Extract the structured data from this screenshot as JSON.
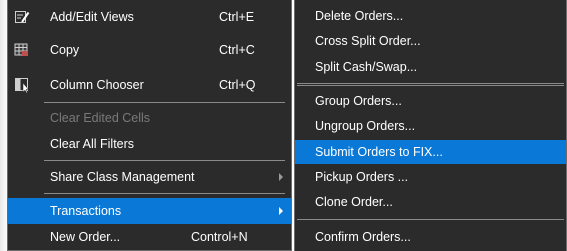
{
  "main_menu": {
    "items": [
      {
        "label": "Add/Edit Views",
        "shortcut": "Ctrl+E",
        "icon": "edit-views-icon"
      },
      {
        "label": "Copy",
        "shortcut": "Ctrl+C",
        "icon": "copy-grid-icon"
      },
      {
        "label": "Column Chooser",
        "shortcut": "Ctrl+Q",
        "icon": "column-chooser-icon"
      },
      {
        "label": "Clear Edited Cells",
        "shortcut": "",
        "disabled": true
      },
      {
        "label": "Clear All Filters",
        "shortcut": ""
      },
      {
        "label": "Share Class Management",
        "shortcut": "",
        "submenu": true
      },
      {
        "label": "Transactions",
        "shortcut": "",
        "submenu": true,
        "highlighted": true
      },
      {
        "label": "New Order...",
        "shortcut": "Control+N"
      }
    ]
  },
  "sub_menu": {
    "items": [
      {
        "label": "Delete Orders..."
      },
      {
        "label": "Cross Split Order..."
      },
      {
        "label": "Split Cash/Swap..."
      },
      {
        "label": "Group Orders..."
      },
      {
        "label": "Ungroup Orders..."
      },
      {
        "label": "Submit Orders to FIX...",
        "highlighted": true
      },
      {
        "label": "Pickup Orders ..."
      },
      {
        "label": "Clone Order..."
      },
      {
        "label": "Confirm Orders..."
      }
    ]
  },
  "colors": {
    "menu_bg": "#2b2b2b",
    "highlight": "#0a78d7",
    "text": "#ffffff",
    "disabled_text": "#7a7a7a",
    "separator": "#8a8a8a"
  }
}
